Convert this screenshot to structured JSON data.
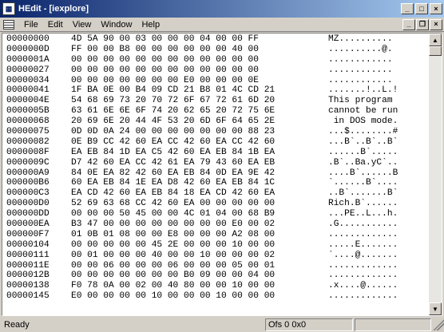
{
  "window": {
    "title": "HEdit - [iexplore]",
    "app_icon": "hedit-app-icon",
    "controls": {
      "minimize": "_",
      "maximize": "□",
      "close": "×"
    }
  },
  "menubar": {
    "items": [
      {
        "label": "File",
        "mnemonic": "F"
      },
      {
        "label": "Edit",
        "mnemonic": "E"
      },
      {
        "label": "View",
        "mnemonic": "V"
      },
      {
        "label": "Window",
        "mnemonic": "W"
      },
      {
        "label": "Help",
        "mnemonic": "H"
      }
    ],
    "mdi_controls": {
      "minimize": "_",
      "restore": "❐",
      "close": "×"
    }
  },
  "hex": {
    "rows": [
      {
        "addr": "00000000",
        "bytes": "4D 5A 90 00 03 00 00 00 04 00 00 FF",
        "ascii": "MZ.........."
      },
      {
        "addr": "0000000D",
        "bytes": "FF 00 00 B8 00 00 00 00 00 00 40 00",
        "ascii": "..........@."
      },
      {
        "addr": "0000001A",
        "bytes": "00 00 00 00 00 00 00 00 00 00 00 00",
        "ascii": "............"
      },
      {
        "addr": "00000027",
        "bytes": "00 00 00 00 00 00 00 00 00 00 00 00",
        "ascii": "............"
      },
      {
        "addr": "00000034",
        "bytes": "00 00 00 00 00 00 00 E0 00 00 00 0E",
        "ascii": "............"
      },
      {
        "addr": "00000041",
        "bytes": "1F BA 0E 00 B4 09 CD 21 B8 01 4C CD 21",
        "ascii": ".......!..L.!"
      },
      {
        "addr": "0000004E",
        "bytes": "54 68 69 73 20 70 72 6F 67 72 61 6D 20",
        "ascii": "This program "
      },
      {
        "addr": "0000005B",
        "bytes": "63 61 6E 6E 6F 74 20 62 65 20 72 75 6E",
        "ascii": "cannot be run"
      },
      {
        "addr": "00000068",
        "bytes": "20 69 6E 20 44 4F 53 20 6D 6F 64 65 2E",
        "ascii": " in DOS mode."
      },
      {
        "addr": "00000075",
        "bytes": "0D 0D 0A 24 00 00 00 00 00 00 00 88 23",
        "ascii": "...$........#"
      },
      {
        "addr": "00000082",
        "bytes": "0E B9 CC 42 60 EA CC 42 60 EA CC 42 60",
        "ascii": "...B`..B`..B`"
      },
      {
        "addr": "0000008F",
        "bytes": "EA EB 84 1D EA C5 42 60 EA EB 84 1B EA",
        "ascii": "......B`....."
      },
      {
        "addr": "0000009C",
        "bytes": "D7 42 60 EA CC 42 61 EA 79 43 60 EA EB",
        "ascii": ".B`..Ba.yC`.."
      },
      {
        "addr": "000000A9",
        "bytes": "84 0E EA 82 42 60 EA EB 84 0D EA 9E 42",
        "ascii": "....B`......B"
      },
      {
        "addr": "000000B6",
        "bytes": "60 EA EB 84 1E EA D8 42 60 EA EB 84 1C",
        "ascii": "`......B`...."
      },
      {
        "addr": "000000C3",
        "bytes": "EA CD 42 60 EA EB 84 18 EA CD 42 60 EA",
        "ascii": "..B`.......B`"
      },
      {
        "addr": "000000D0",
        "bytes": "52 69 63 68 CC 42 60 EA 00 00 00 00 00",
        "ascii": "Rich.B`......"
      },
      {
        "addr": "000000DD",
        "bytes": "00 00 00 50 45 00 00 4C 01 04 00 68 B9",
        "ascii": "...PE..L...h."
      },
      {
        "addr": "000000EA",
        "bytes": "B3 47 00 00 00 00 00 00 00 00 E0 00 02",
        "ascii": ".G..........."
      },
      {
        "addr": "000000F7",
        "bytes": "01 0B 01 08 00 00 E8 00 00 00 A2 08 00",
        "ascii": "............."
      },
      {
        "addr": "00000104",
        "bytes": "00 00 00 00 00 45 2E 00 00 00 10 00 00",
        "ascii": ".....E......."
      },
      {
        "addr": "00000111",
        "bytes": "00 01 00 00 00 40 00 00 10 00 00 00 02",
        "ascii": "`....@......."
      },
      {
        "addr": "0000011E",
        "bytes": "00 00 06 00 00 00 06 00 00 00 05 00 01",
        "ascii": "............."
      },
      {
        "addr": "0000012B",
        "bytes": "00 00 00 00 00 00 00 B0 09 00 00 04 00",
        "ascii": "............."
      },
      {
        "addr": "00000138",
        "bytes": "F0 78 0A 00 02 00 40 80 00 00 10 00 00",
        "ascii": ".x....@......"
      },
      {
        "addr": "00000145",
        "bytes": "E0 00 00 00 00 10 00 00 00 10 00 00 00",
        "ascii": "............."
      }
    ]
  },
  "statusbar": {
    "ready": "Ready",
    "offset": "Ofs 0  0x0",
    "extra": ""
  }
}
